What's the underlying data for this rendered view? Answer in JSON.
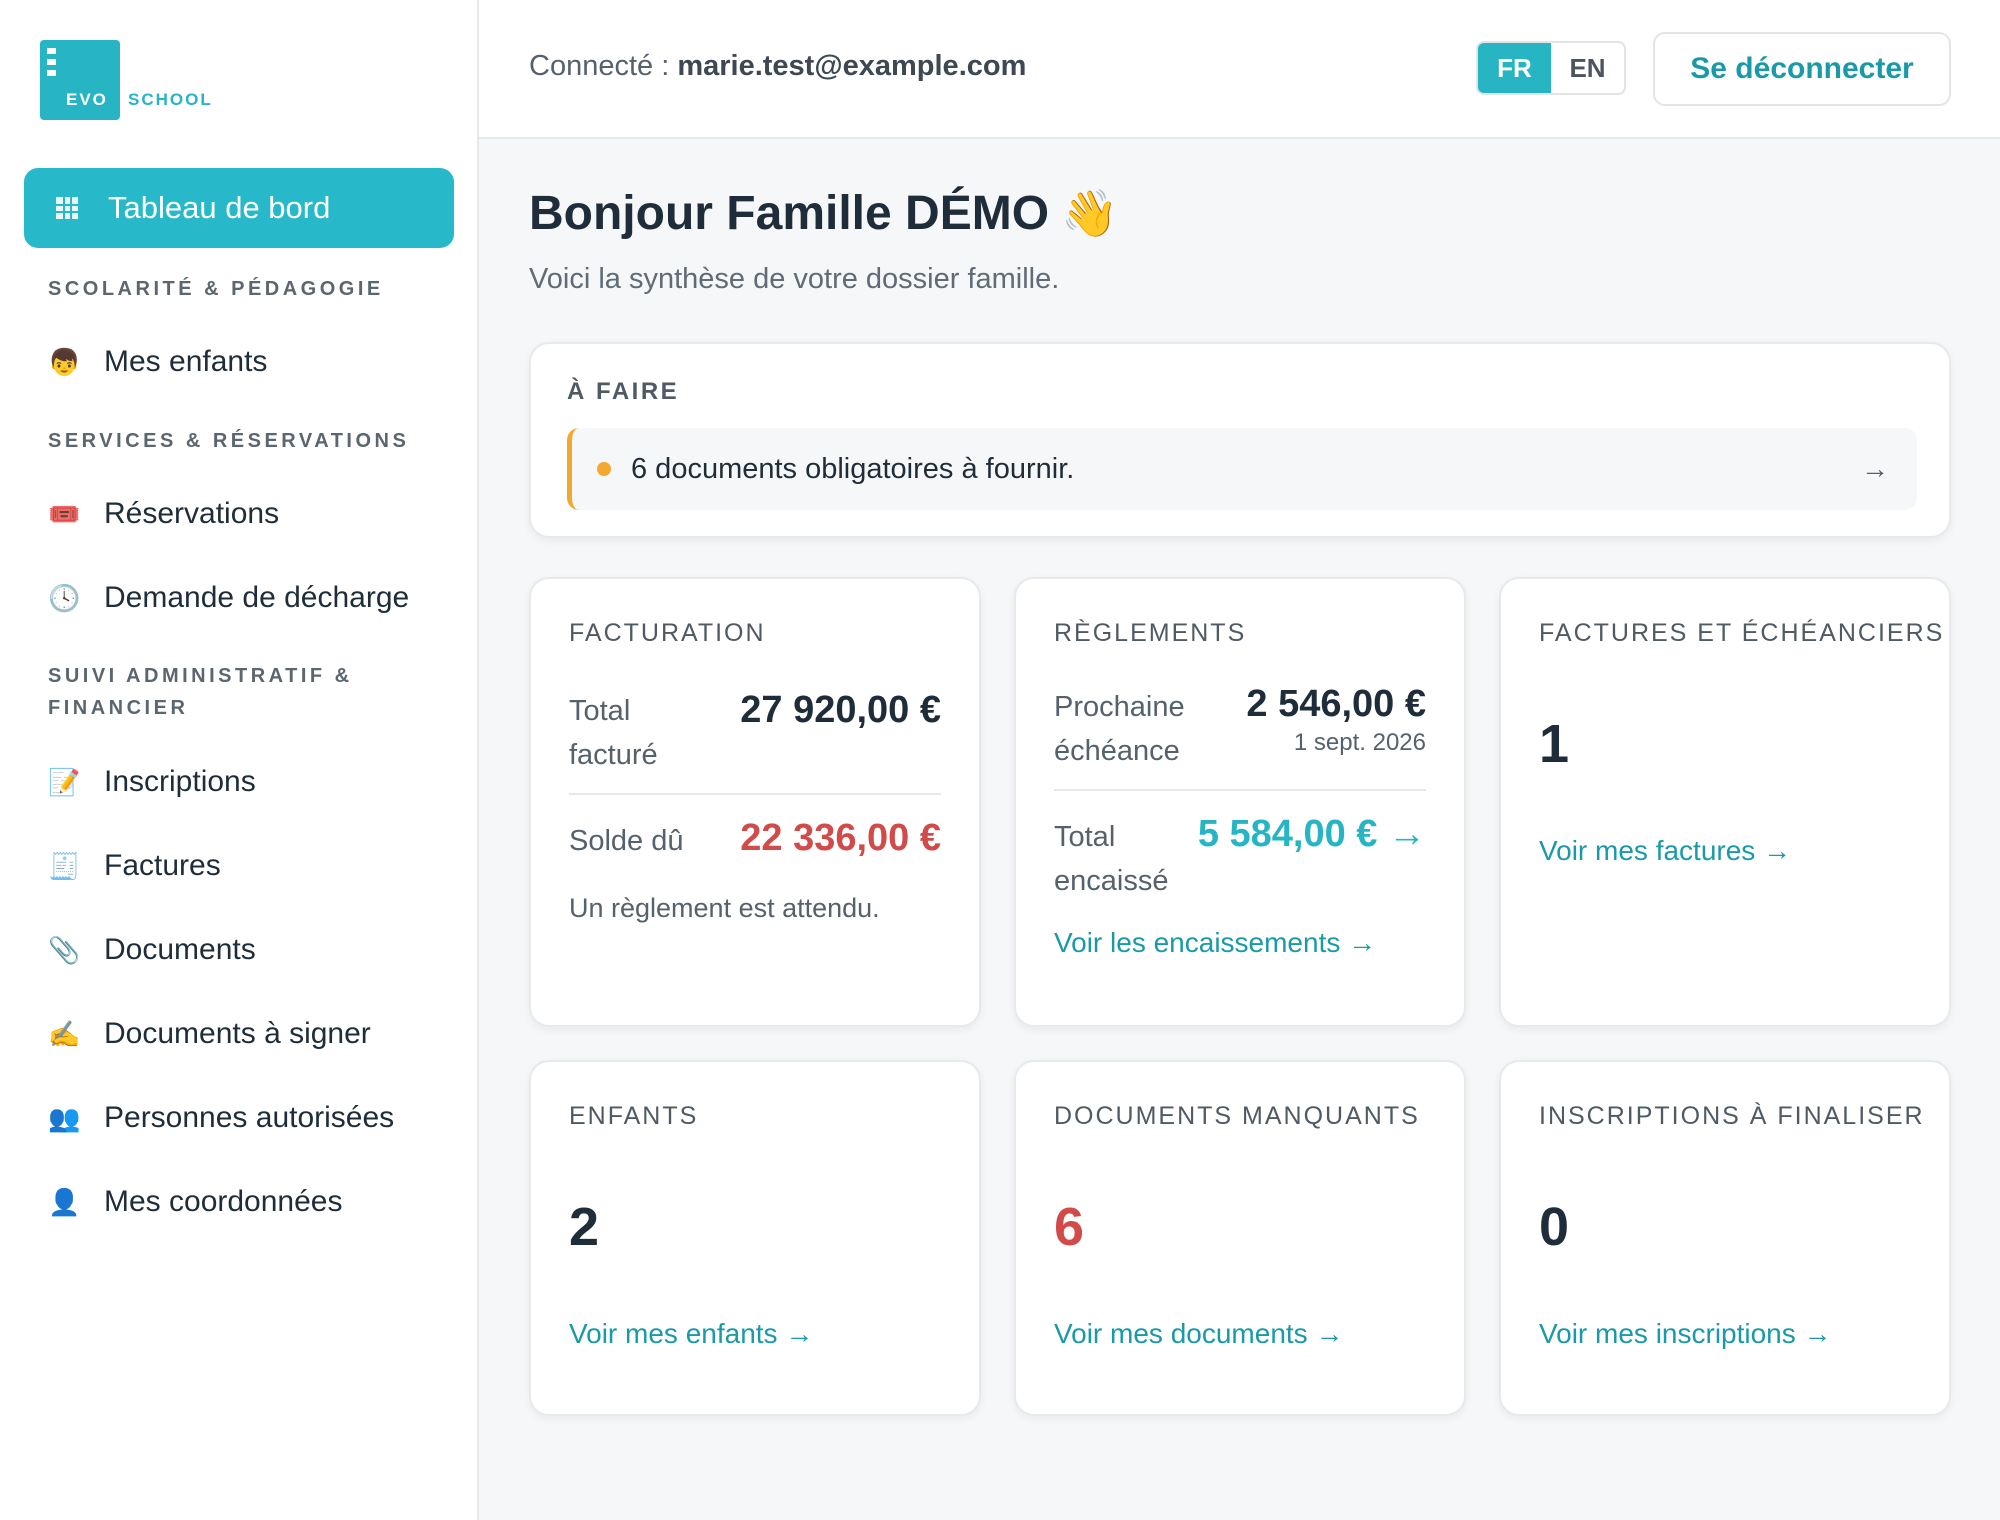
{
  "app": {
    "logo_primary": "EVO",
    "logo_secondary": "SCHOOL",
    "brand_color": "#27b4c3"
  },
  "sidebar": {
    "active_item": {
      "label": "Tableau de bord",
      "icon": "dashboard-grid-icon"
    },
    "sections": [
      {
        "title": "SCOLARITÉ & PÉDAGOGIE",
        "items": [
          {
            "label": "Mes enfants",
            "icon": "child-face-icon",
            "glyph": "👦"
          }
        ]
      },
      {
        "title": "SERVICES & RÉSERVATIONS",
        "items": [
          {
            "label": "Réservations",
            "icon": "ticket-icon",
            "glyph": "🎟️"
          },
          {
            "label": "Demande de décharge",
            "icon": "clock-icon",
            "glyph": "🕓"
          }
        ]
      },
      {
        "title": "SUIVI ADMINISTRATIF & FINANCIER",
        "items": [
          {
            "label": "Inscriptions",
            "icon": "memo-icon",
            "glyph": "📝"
          },
          {
            "label": "Factures",
            "icon": "receipt-icon",
            "glyph": "🧾"
          },
          {
            "label": "Documents",
            "icon": "paperclip-icon",
            "glyph": "📎"
          },
          {
            "label": "Documents à signer",
            "icon": "writing-hand-icon",
            "glyph": "✍️"
          },
          {
            "label": "Personnes autorisées",
            "icon": "people-icon",
            "glyph": "👥"
          },
          {
            "label": "Mes coordonnées",
            "icon": "person-icon",
            "glyph": "👤"
          }
        ]
      }
    ]
  },
  "topbar": {
    "connected_label": "Connecté :",
    "user_email": "marie.test@example.com",
    "lang_active": "FR",
    "lang_other": "EN",
    "logout_label": "Se déconnecter"
  },
  "main": {
    "greeting": "Bonjour Famille DÉMO",
    "greeting_emoji": "👋",
    "subtitle": "Voici la synthèse de votre dossier famille.",
    "todo": {
      "title": "À FAIRE",
      "item": "6 documents obligatoires à fournir.",
      "arrow": "→",
      "accent_color": "#f3a92f"
    },
    "facturation": {
      "title": "FACTURATION",
      "total_label": "Total facturé",
      "total_value": "27 920,00 €",
      "balance_label": "Solde dû",
      "balance_value": "22 336,00 €",
      "note": "Un règlement est attendu."
    },
    "reglements": {
      "title": "RÈGLEMENTS",
      "next_label": "Prochaine échéance",
      "next_value": "2 546,00 €",
      "next_date": "1 sept. 2026",
      "collected_label": "Total encaissé",
      "collected_value": "5 584,00 € →",
      "link": "Voir les encaissements →"
    },
    "factures": {
      "title": "FACTURES ET ÉCHÉANCIERS",
      "count": "1",
      "link": "Voir mes factures →"
    },
    "enfants": {
      "title": "ENFANTS",
      "count": "2",
      "link": "Voir mes enfants →"
    },
    "documents": {
      "title": "DOCUMENTS MANQUANTS",
      "count": "6",
      "link": "Voir mes documents →"
    },
    "inscriptions": {
      "title": "INSCRIPTIONS À FINALISER",
      "count": "0",
      "link": "Voir mes inscriptions →"
    }
  }
}
